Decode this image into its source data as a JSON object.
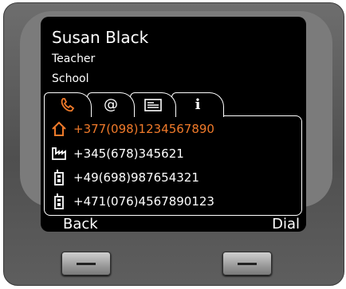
{
  "contact": {
    "name": "Susan Black",
    "title": "Teacher",
    "organization": "School"
  },
  "tabs": [
    {
      "icon": "phone-handset-icon",
      "glyph": "✆"
    },
    {
      "icon": "email-at-icon",
      "glyph": "@"
    },
    {
      "icon": "vcard-icon",
      "glyph": "▤"
    },
    {
      "icon": "info-icon",
      "glyph": "i"
    }
  ],
  "numbers": [
    {
      "icon": "home-icon",
      "number": "+377(098)1234567890",
      "selected": true
    },
    {
      "icon": "office-icon",
      "number": "+345(678)345621",
      "selected": false
    },
    {
      "icon": "mobile-icon",
      "number": "+49(698)987654321",
      "selected": false
    },
    {
      "icon": "mobile-icon",
      "number": "+471(076)4567890123",
      "selected": false
    }
  ],
  "softkeys": {
    "left": "Back",
    "right": "Dial"
  },
  "colors": {
    "accent": "#f07a2a",
    "screen": "#000000"
  }
}
